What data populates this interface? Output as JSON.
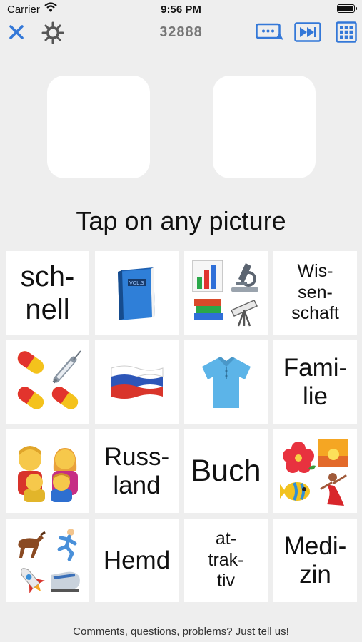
{
  "status_bar": {
    "carrier": "Carrier",
    "time": "9:56 PM"
  },
  "toolbar": {
    "score": "32888"
  },
  "instruction": "Tap on any picture",
  "cards": {
    "r1": {
      "c1": "sch-\nnell",
      "c2_icon": "blue-book-icon",
      "c3_icon": "science-collage-icon",
      "c4": "Wis-\nsen-\nschaft"
    },
    "r2": {
      "c1_icon": "pills-and-syringe-icon",
      "c2_icon": "russia-flag-icon",
      "c3_icon": "shirt-icon",
      "c4": "Fami-\nlie"
    },
    "r3": {
      "c1_icon": "family-icon",
      "c2": "Russ-\nland",
      "c3": "Buch",
      "c4_icon": "travel-collage-icon"
    },
    "r4": {
      "c1_icon": "fast-things-icon",
      "c2": "Hemd",
      "c3": "at-\ntrak-\ntiv",
      "c4": "Medi-\nzin"
    }
  },
  "footer": "Comments, questions, problems? Just tell us!",
  "colors": {
    "accent": "#3478d8",
    "background": "#eeeeee",
    "card": "#ffffff"
  }
}
